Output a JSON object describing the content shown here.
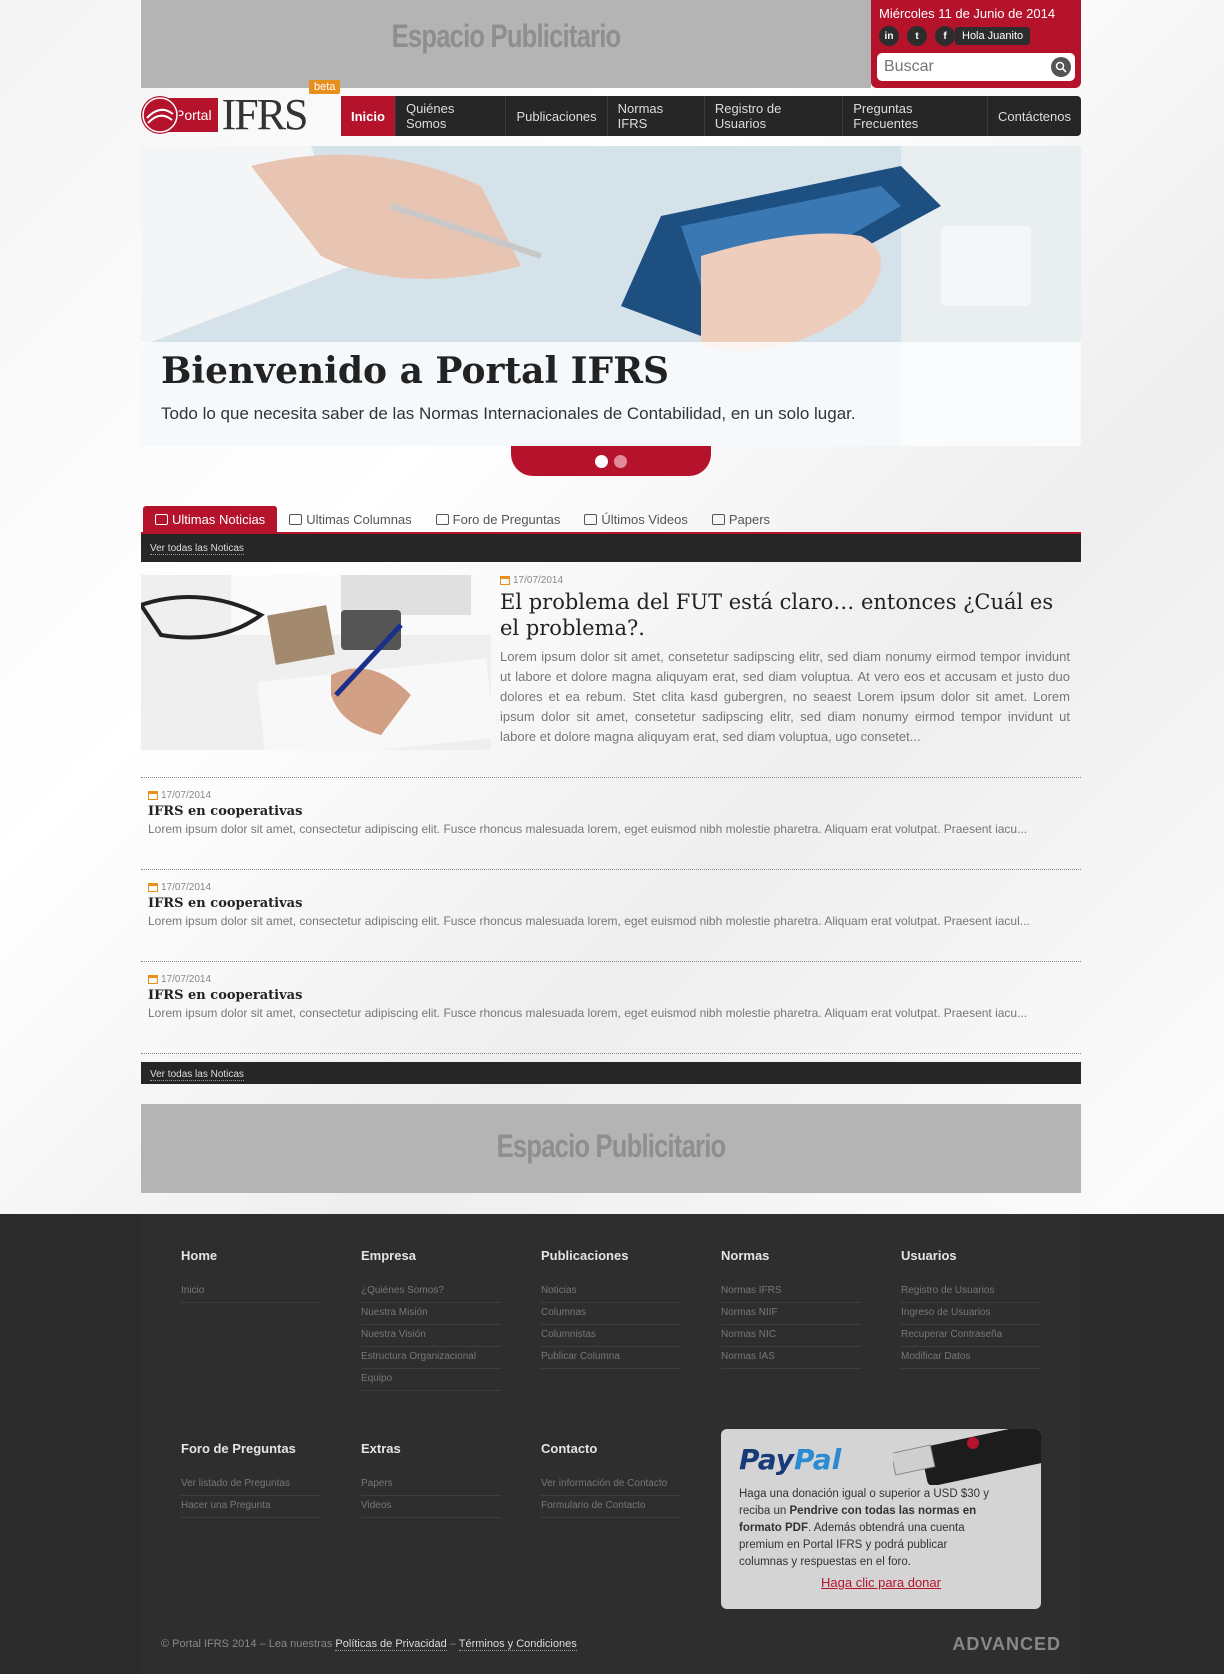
{
  "ads": {
    "top": "Espacio Publicitario",
    "bottom": "Espacio Publicitario"
  },
  "user": {
    "date": "Miércoles 11 de Junio de 2014",
    "greeting": "Hola Juanito",
    "social": [
      "in",
      "t",
      "f"
    ],
    "search_placeholder": "Buscar"
  },
  "logo": {
    "portal": "Portal",
    "ifrs": "IFRS",
    "beta": "beta"
  },
  "nav": [
    "Inicio",
    "Quiénes Somos",
    "Publicaciones",
    "Normas IFRS",
    "Registro de Usuarios",
    "Preguntas Frecuentes",
    "Contáctenos"
  ],
  "slider": {
    "title": "Bienvenido a Portal IFRS",
    "subtitle": "Todo lo que necesita saber de las Normas Internacionales de Contabilidad, en un solo lugar."
  },
  "tabs": [
    "Ultimas Noticias",
    "Ultimas Columnas",
    "Foro de Preguntas",
    "Últimos Videos",
    "Papers"
  ],
  "see_all": "Ver todas las Noticas",
  "featured": {
    "date": "17/07/2014",
    "title": "El problema del FUT está claro… entonces ¿Cuál es el problema?.",
    "body": "Lorem ipsum dolor sit amet, consetetur sadipscing elitr, sed diam nonumy eirmod tempor invidunt ut labore et dolore magna aliquyam erat, sed diam voluptua. At vero eos et accusam et justo duo dolores et ea rebum. Stet clita kasd gubergren, no seaest Lorem ipsum dolor sit amet. Lorem ipsum dolor sit amet, consetetur sadipscing elitr, sed diam nonumy eirmod tempor invidunt ut labore et dolore magna aliquyam erat, sed diam voluptua, ugo consetet..."
  },
  "news": [
    {
      "date": "17/07/2014",
      "title": "IFRS en cooperativas",
      "body": "Lorem ipsum dolor sit amet, consectetur adipiscing elit. Fusce rhoncus malesuada lorem, eget euismod nibh molestie pharetra. Aliquam erat volutpat. Praesent iacu..."
    },
    {
      "date": "17/07/2014",
      "title": "IFRS en cooperativas",
      "body": "Lorem ipsum dolor sit amet, consectetur adipiscing elit. Fusce rhoncus malesuada lorem, eget euismod nibh molestie pharetra. Aliquam erat volutpat. Praesent iacul..."
    },
    {
      "date": "17/07/2014",
      "title": "IFRS en cooperativas",
      "body": "Lorem ipsum dolor sit amet, consectetur adipiscing elit. Fusce rhoncus malesuada lorem, eget euismod nibh molestie pharetra. Aliquam erat volutpat. Praesent iacu..."
    }
  ],
  "footer": {
    "cols": [
      {
        "title": "Home",
        "links": [
          "Inicio"
        ]
      },
      {
        "title": "Empresa",
        "links": [
          "¿Quiénes Somos?",
          "Nuestra Misión",
          "Nuestra Visión",
          "Estructura Organizacional",
          "Equipo"
        ]
      },
      {
        "title": "Publicaciones",
        "links": [
          "Noticias",
          "Columnas",
          "Columnistas",
          "Publicar Columna"
        ]
      },
      {
        "title": "Normas",
        "links": [
          "Normas IFRS",
          "Normas NIIF",
          "Normas NIC",
          "Normas IAS"
        ]
      },
      {
        "title": "Usuarios",
        "links": [
          "Registro de Usuarios",
          "Ingreso de Usuarios",
          "Recuperar Contraseña",
          "Modificar Datos"
        ]
      },
      {
        "title": "Foro de Preguntas",
        "links": [
          "Ver listado de Preguntas",
          "Hacer una Pregunta"
        ]
      },
      {
        "title": "Extras",
        "links": [
          "Papers",
          "Videos"
        ]
      },
      {
        "title": "Contacto",
        "links": [
          "Ver información de Contacto",
          "Formulario de Contacto"
        ]
      }
    ],
    "paypal": {
      "logo_a": "Pay",
      "logo_b": "Pal",
      "text_1": "Haga una donación igual o superior a USD $30 y reciba un ",
      "text_bold": "Pendrive con todas las normas en formato PDF",
      "text_2": ". Además obtendrá una cuenta premium en Portal IFRS y podrá publicar columnas y respuestas en el foro.",
      "link": "Haga clic para donar"
    },
    "copyright": "© Portal IFRS 2014 – Lea nuestras ",
    "privacy": "Políticas de Privacidad",
    "dash": " – ",
    "terms": "Términos y Condiciones",
    "brand": "ADVANCED"
  },
  "colors": {
    "accent": "#b5122c",
    "dark": "#262626",
    "ad_bg": "#b4b4b4"
  }
}
